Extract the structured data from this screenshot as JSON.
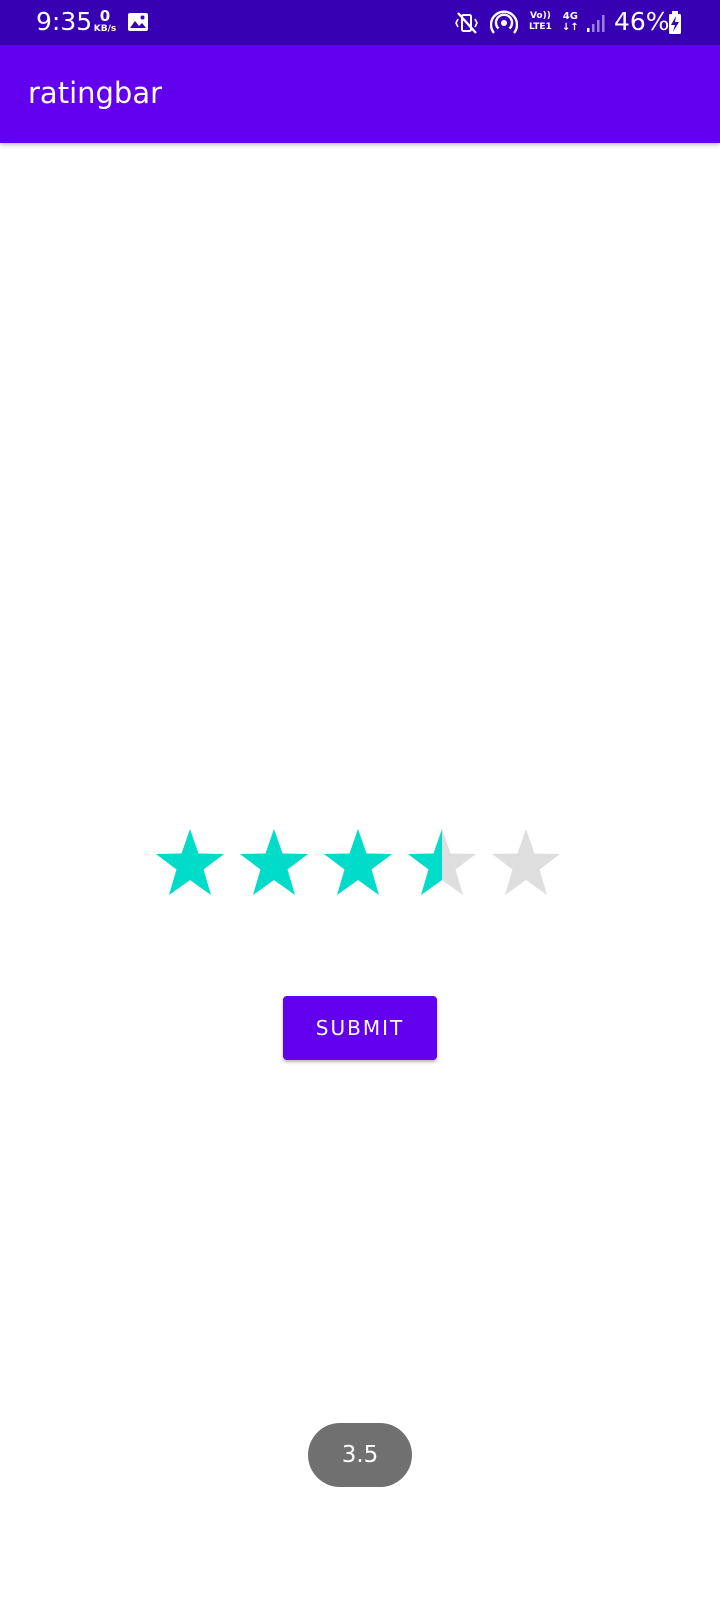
{
  "status_bar": {
    "time": "9:35",
    "net_speed": "0",
    "net_speed_unit": "KB/s",
    "volte_top": "Vo))",
    "volte_bottom": "LTE1",
    "network_type": "4G",
    "battery": "46%",
    "icons": [
      "gallery-icon",
      "mute-vibrate-icon",
      "hotspot-icon",
      "signal-icon",
      "battery-charging-icon"
    ]
  },
  "app_bar": {
    "title": "ratingbar"
  },
  "rating": {
    "value": 3.5,
    "max": 5,
    "filled_color": "#00dcc9",
    "empty_color": "#dedede"
  },
  "submit": {
    "label": "SUBMIT"
  },
  "toast": {
    "text": "3.5"
  },
  "colors": {
    "status_bar": "#3700b3",
    "primary": "#6200ee",
    "toast": "#707070"
  }
}
